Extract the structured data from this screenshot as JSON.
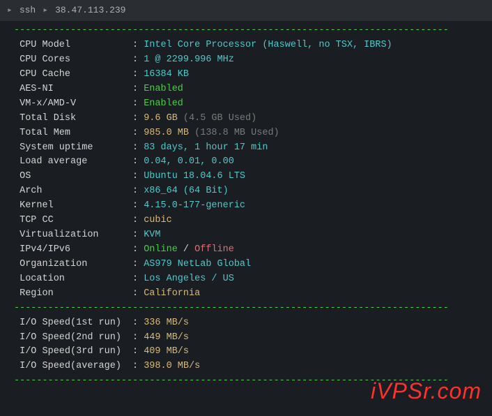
{
  "titlebar": {
    "ssh_label": "ssh",
    "arrow": "▸",
    "host": "38.47.113.239"
  },
  "divider": "-----------------------------------------------------------------------------",
  "rows": [
    {
      "label": " CPU Model          ",
      "parts": [
        {
          "cls": "cyan",
          "text": "Intel Core Processor (Haswell, no TSX, IBRS)"
        }
      ]
    },
    {
      "label": " CPU Cores          ",
      "parts": [
        {
          "cls": "cyan",
          "text": "1 @ 2299.996 MHz"
        }
      ]
    },
    {
      "label": " CPU Cache          ",
      "parts": [
        {
          "cls": "cyan",
          "text": "16384 KB"
        }
      ]
    },
    {
      "label": " AES-NI             ",
      "parts": [
        {
          "cls": "green",
          "text": "Enabled"
        }
      ]
    },
    {
      "label": " VM-x/AMD-V         ",
      "parts": [
        {
          "cls": "green",
          "text": "Enabled"
        }
      ]
    },
    {
      "label": " Total Disk         ",
      "parts": [
        {
          "cls": "yellow",
          "text": "9.6 GB "
        },
        {
          "cls": "gray",
          "text": "(4.5 GB Used)"
        }
      ]
    },
    {
      "label": " Total Mem          ",
      "parts": [
        {
          "cls": "yellow",
          "text": "985.0 MB "
        },
        {
          "cls": "gray",
          "text": "(138.8 MB Used)"
        }
      ]
    },
    {
      "label": " System uptime      ",
      "parts": [
        {
          "cls": "cyan",
          "text": "83 days, 1 hour 17 min"
        }
      ]
    },
    {
      "label": " Load average       ",
      "parts": [
        {
          "cls": "cyan",
          "text": "0.04, 0.01, 0.00"
        }
      ]
    },
    {
      "label": " OS                 ",
      "parts": [
        {
          "cls": "cyan",
          "text": "Ubuntu 18.04.6 LTS"
        }
      ]
    },
    {
      "label": " Arch               ",
      "parts": [
        {
          "cls": "cyan",
          "text": "x86_64 (64 Bit)"
        }
      ]
    },
    {
      "label": " Kernel             ",
      "parts": [
        {
          "cls": "cyan",
          "text": "4.15.0-177-generic"
        }
      ]
    },
    {
      "label": " TCP CC             ",
      "parts": [
        {
          "cls": "yellow",
          "text": "cubic"
        }
      ]
    },
    {
      "label": " Virtualization     ",
      "parts": [
        {
          "cls": "cyan",
          "text": "KVM"
        }
      ]
    },
    {
      "label": " IPv4/IPv6          ",
      "parts": [
        {
          "cls": "green",
          "text": "Online"
        },
        {
          "cls": "white",
          "text": " / "
        },
        {
          "cls": "red",
          "text": "Offline"
        }
      ]
    },
    {
      "label": " Organization       ",
      "parts": [
        {
          "cls": "cyan",
          "text": "AS979 NetLab Global"
        }
      ]
    },
    {
      "label": " Location           ",
      "parts": [
        {
          "cls": "cyan",
          "text": "Los Angeles / US"
        }
      ]
    },
    {
      "label": " Region             ",
      "parts": [
        {
          "cls": "yellow",
          "text": "California"
        }
      ]
    }
  ],
  "io_rows": [
    {
      "label": " I/O Speed(1st run) ",
      "parts": [
        {
          "cls": "yellow",
          "text": "336 MB/s"
        }
      ]
    },
    {
      "label": " I/O Speed(2nd run) ",
      "parts": [
        {
          "cls": "yellow",
          "text": "449 MB/s"
        }
      ]
    },
    {
      "label": " I/O Speed(3rd run) ",
      "parts": [
        {
          "cls": "yellow",
          "text": "409 MB/s"
        }
      ]
    },
    {
      "label": " I/O Speed(average) ",
      "parts": [
        {
          "cls": "yellow",
          "text": "398.0 MB/s"
        }
      ]
    }
  ],
  "watermark": {
    "text": "iVPSr.com"
  }
}
